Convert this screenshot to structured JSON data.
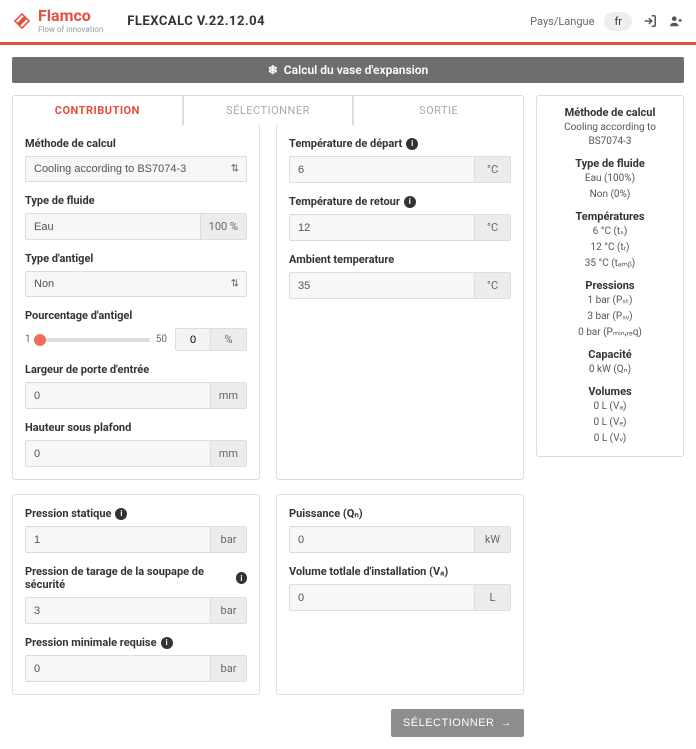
{
  "header": {
    "brand": "Flamco",
    "tag": "Flow of innovation",
    "app": "FLEXCALC V.22.12.04",
    "lang_label": "Pays/Langue",
    "lang_value": "fr"
  },
  "titlebar": "Calcul du vase d'expansion",
  "tabs": {
    "t1": "CONTRIBUTION",
    "t2": "SÉLECTIONNER",
    "t3": "SORTIE"
  },
  "left": {
    "method_label": "Méthode de calcul",
    "method_value": "Cooling according to BS7074-3",
    "fluid_label": "Type de fluide",
    "fluid_value": "Eau",
    "fluid_unit": "100 %",
    "antifreeze_label": "Type d'antigel",
    "antifreeze_value": "Non",
    "pct_label": "Pourcentage d'antigel",
    "pct_min": "1",
    "pct_max": "50",
    "pct_val": "0",
    "pct_unit": "%",
    "door_label": "Largeur de porte d'entrée",
    "door_val": "0",
    "door_unit": "mm",
    "ceil_label": "Hauteur sous plafond",
    "ceil_val": "0",
    "ceil_unit": "mm"
  },
  "right": {
    "tflow_label": "Température de départ",
    "tflow_val": "6",
    "tflow_unit": "°C",
    "tret_label": "Température de retour",
    "tret_val": "12",
    "tret_unit": "°C",
    "tamb_label": "Ambient temperature",
    "tamb_val": "35",
    "tamb_unit": "°C"
  },
  "left2": {
    "pst_label": "Pression statique",
    "pst_val": "1",
    "pst_unit": "bar",
    "psv_label": "Pression de tarage de la soupape de sécurité",
    "psv_val": "3",
    "psv_unit": "bar",
    "pmin_label": "Pression minimale requise",
    "pmin_val": "0",
    "pmin_unit": "bar"
  },
  "right2": {
    "qn_label": "Puissance (Qₙ)",
    "qn_val": "0",
    "qn_unit": "kW",
    "va_label": "Volume totlale d'installation (Vₐ)",
    "va_val": "0",
    "va_unit": "L"
  },
  "side": {
    "h1": "Méthode de calcul",
    "v1": "Cooling according to BS7074-3",
    "h2": "Type de fluide",
    "v2a": "Eau (100%)",
    "v2b": "Non (0%)",
    "h3": "Températures",
    "v3a": "6 °C (tₛ)",
    "v3b": "12 °C (tᵣ)",
    "v3c": "35 °C (tₐₘᵦ)",
    "h4": "Pressions",
    "v4a": "1 bar (Pₛₜ)",
    "v4b": "3 bar (Pₛᵥ)",
    "v4c": "0 bar (Pₘᵢₙ,ᵣₑq)",
    "h5": "Capacité",
    "v5": "0 kW (Qₙ)",
    "h6": "Volumes",
    "v6a": "0 L (Vₐ)",
    "v6b": "0 L (Vₑ)",
    "v6c": "0 L (Vᵥ)"
  },
  "next": "SÉLECTIONNER"
}
